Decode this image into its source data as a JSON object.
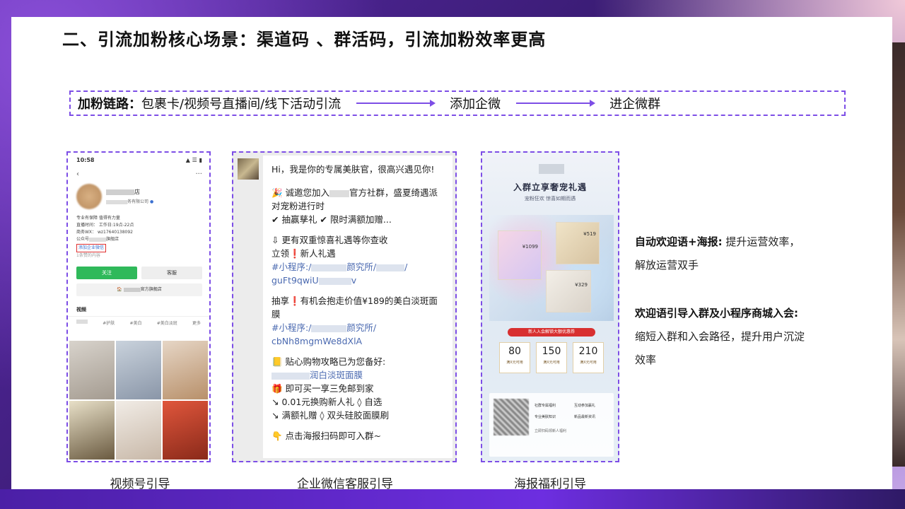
{
  "slide": {
    "title": "二、引流加粉核心场景：渠道码 、群活码，引流加粉效率更高",
    "chain": {
      "lead": "加粉链路：",
      "step1": "包裹卡/视频号直播间/线下活动引流",
      "step2": "添加企微",
      "step3": "进企微群"
    },
    "captions": {
      "video": "视频号引导",
      "wecom": "企业微信客服引导",
      "poster": "海报福利引导"
    },
    "right_text": {
      "p1_bold": "自动欢迎语+海报:",
      "p1_rest": "提升运营效率，",
      "p1_line2": "解放运营双手",
      "p2_bold": "欢迎语引导入群及小程序商城入会:",
      "p2_line1": "缩短入群和入会路径，提升用户沉淀",
      "p2_line2": "效率"
    }
  },
  "video_phone": {
    "time": "10:58",
    "status_icons": "▲ ☰ ▮",
    "back": "‹",
    "more": "···",
    "name_suffix": "店",
    "company": "务有限公司",
    "line1": "专业有保障 值得有力量",
    "line2": "直播时间： 工作日:19点-22点",
    "line3": "商务WX： wz17640138092",
    "line4": "公众号",
    "line4_suffix": "旗舰店",
    "add_wecom": "添加企业微信",
    "line6": "1条赞的内容",
    "follow": "关注",
    "service": "客服",
    "shop": "官方旗舰店",
    "tab_video": "视频",
    "tag1": "#护肤",
    "tag2": "#美白",
    "tag3": "#美白淡斑",
    "tag_more": "更多"
  },
  "wecom_chat": {
    "l1": "Hi，我是你的专属美肤官，很高兴遇见你!",
    "l2": "🎉 诚邀您加入",
    "l2b": "官方社群，盛夏绮遇派",
    "l3": "对宠粉进行时",
    "l4": "✔ 抽赢孳礼 ✔ 限时满额加赠...",
    "l5": "⇩ 更有双重惊喜礼遇等你查收",
    "l6": "立领❗新人礼遇",
    "l7": "#小程序:/",
    "l7b": "颜究所/",
    "l8": "guFt9qwiU",
    "l9": "抽享❗有机会抱走价值¥189的美白淡斑面",
    "l10": "膜",
    "l11": "#小程序:/",
    "l11b": "颜究所/",
    "l12": "cbNh8mgmWe8dXlA",
    "l13": "📒 贴心购物攻略已为您备好:",
    "l14": "润白淡斑面膜",
    "l15": "🎁 即可买一享三免邮到家",
    "l16": "↘ 0.01元换购新人礼 ◊ 自选",
    "l17": "↘ 满额礼赠 ◊ 双头硅胶面膜刷",
    "l18": "👇 点击海报扫码即可入群~"
  },
  "poster": {
    "headline": "入群立享奢宠礼遇",
    "sub": "宠粉狂欢 惊喜如期而遇",
    "price1": "¥1099",
    "price2": "¥519",
    "price3": "¥329",
    "ribbon": "新人入会解锁大额优惠券",
    "coupon1": "80",
    "coupon2": "150",
    "coupon3": "210",
    "coupon_label": "满X元可用",
    "f1": "社群专属福利",
    "f2": "互动参加赢礼",
    "f3": "专业美肤知识",
    "f4": "新品最新资讯",
    "f5": "立即扫码领新人福利"
  },
  "colors": {
    "accent": "#7d4ee6",
    "follow_green": "#2fb95a",
    "link_blue": "#4a69b0",
    "ribbon_red": "#d83030"
  }
}
